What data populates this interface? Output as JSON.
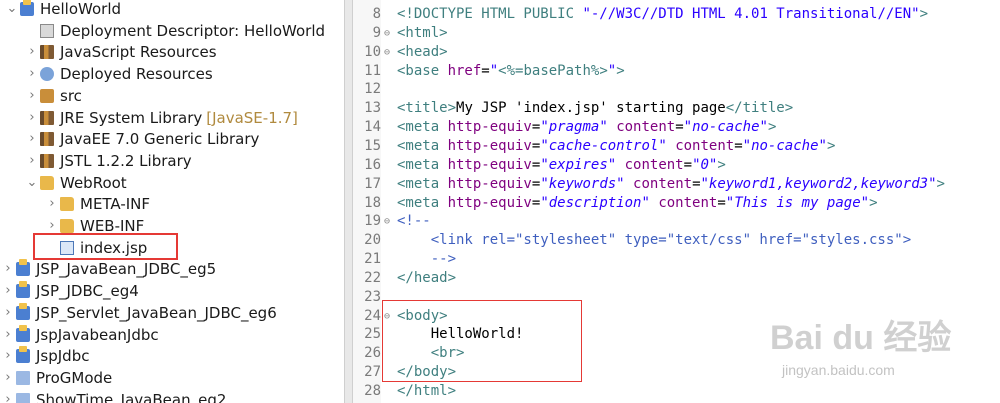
{
  "explorer": {
    "items": [
      {
        "label": "HelloWorld",
        "decoration": "",
        "icon": "project-icon",
        "expanded": true
      },
      {
        "label": "Deployment Descriptor: HelloWorld",
        "decoration": "",
        "icon": "descriptor-icon"
      },
      {
        "label": "JavaScript Resources",
        "decoration": "",
        "icon": "library-icon"
      },
      {
        "label": "Deployed Resources",
        "decoration": "",
        "icon": "deployed-icon"
      },
      {
        "label": "src",
        "decoration": "",
        "icon": "src-icon"
      },
      {
        "label": "JRE System Library",
        "decoration": "[JavaSE-1.7]",
        "icon": "library-icon"
      },
      {
        "label": "JavaEE 7.0 Generic Library",
        "decoration": "",
        "icon": "library-icon"
      },
      {
        "label": "JSTL 1.2.2 Library",
        "decoration": "",
        "icon": "library-icon"
      },
      {
        "label": "WebRoot",
        "decoration": "",
        "icon": "folder-icon",
        "expanded": true
      },
      {
        "label": "META-INF",
        "decoration": "",
        "icon": "folder-icon"
      },
      {
        "label": "WEB-INF",
        "decoration": "",
        "icon": "folder-icon"
      },
      {
        "label": "index.jsp",
        "decoration": "",
        "icon": "jsp-file-icon",
        "highlighted": true
      },
      {
        "label": "JSP_JavaBean_JDBC_eg5",
        "decoration": "",
        "icon": "project-icon"
      },
      {
        "label": "JSP_JDBC_eg4",
        "decoration": "",
        "icon": "project-icon"
      },
      {
        "label": "JSP_Servlet_JavaBean_JDBC_eg6",
        "decoration": "",
        "icon": "project-icon"
      },
      {
        "label": "JspJavabeanJdbc",
        "decoration": "",
        "icon": "project-icon"
      },
      {
        "label": "JspJdbc",
        "decoration": "",
        "icon": "project-icon"
      },
      {
        "label": "ProGMode",
        "decoration": "",
        "icon": "folder-project-icon"
      },
      {
        "label": "ShowTime_JavaBean_eg2",
        "decoration": "",
        "icon": "folder-project-icon"
      }
    ]
  },
  "editor": {
    "lines": [
      {
        "n": "8",
        "fold": "",
        "parts": [
          [
            "t-dt",
            "<!DOCTYPE HTML PUBLIC "
          ],
          [
            "t-str",
            "\"-//W3C//DTD HTML 4.01 Transitional//EN\""
          ],
          [
            "t-dt",
            ">"
          ]
        ]
      },
      {
        "n": "9",
        "fold": "⊖",
        "parts": [
          [
            "t-tag",
            "<html>"
          ]
        ]
      },
      {
        "n": "10",
        "fold": "⊖",
        "parts": [
          [
            "t-tag",
            "<head>"
          ]
        ]
      },
      {
        "n": "11",
        "fold": "",
        "parts": [
          [
            "t-tag",
            "<base "
          ],
          [
            "t-attr",
            "href"
          ],
          [
            "t-text",
            "="
          ],
          [
            "t-str",
            "\""
          ],
          [
            "t-tag",
            "<%=basePath%>"
          ],
          [
            "t-str",
            "\""
          ],
          [
            "t-tag",
            ">"
          ]
        ]
      },
      {
        "n": "12",
        "fold": "",
        "parts": []
      },
      {
        "n": "13",
        "fold": "",
        "parts": [
          [
            "t-tag",
            "<title>"
          ],
          [
            "t-text",
            "My JSP 'index.jsp' starting page"
          ],
          [
            "t-tag",
            "</title>"
          ]
        ]
      },
      {
        "n": "14",
        "fold": "",
        "parts": [
          [
            "t-tag",
            "<meta "
          ],
          [
            "t-attr",
            "http-equiv"
          ],
          [
            "t-text",
            "="
          ],
          [
            "t-str t-it",
            "\"pragma\""
          ],
          [
            "t-text",
            " "
          ],
          [
            "t-attr",
            "content"
          ],
          [
            "t-text",
            "="
          ],
          [
            "t-str t-it",
            "\"no-cache\""
          ],
          [
            "t-tag",
            ">"
          ]
        ]
      },
      {
        "n": "15",
        "fold": "",
        "parts": [
          [
            "t-tag",
            "<meta "
          ],
          [
            "t-attr",
            "http-equiv"
          ],
          [
            "t-text",
            "="
          ],
          [
            "t-str t-it",
            "\"cache-control\""
          ],
          [
            "t-text",
            " "
          ],
          [
            "t-attr",
            "content"
          ],
          [
            "t-text",
            "="
          ],
          [
            "t-str t-it",
            "\"no-cache\""
          ],
          [
            "t-tag",
            ">"
          ]
        ]
      },
      {
        "n": "16",
        "fold": "",
        "parts": [
          [
            "t-tag",
            "<meta "
          ],
          [
            "t-attr",
            "http-equiv"
          ],
          [
            "t-text",
            "="
          ],
          [
            "t-str t-it",
            "\"expires\""
          ],
          [
            "t-text",
            " "
          ],
          [
            "t-attr",
            "content"
          ],
          [
            "t-text",
            "="
          ],
          [
            "t-str t-it",
            "\"0\""
          ],
          [
            "t-tag",
            ">"
          ]
        ]
      },
      {
        "n": "17",
        "fold": "",
        "parts": [
          [
            "t-tag",
            "<meta "
          ],
          [
            "t-attr",
            "http-equiv"
          ],
          [
            "t-text",
            "="
          ],
          [
            "t-str t-it",
            "\"keywords\""
          ],
          [
            "t-text",
            " "
          ],
          [
            "t-attr",
            "content"
          ],
          [
            "t-text",
            "="
          ],
          [
            "t-str t-it",
            "\"keyword1,keyword2,keyword3\""
          ],
          [
            "t-tag",
            ">"
          ]
        ]
      },
      {
        "n": "18",
        "fold": "",
        "parts": [
          [
            "t-tag",
            "<meta "
          ],
          [
            "t-attr",
            "http-equiv"
          ],
          [
            "t-text",
            "="
          ],
          [
            "t-str t-it",
            "\"description\""
          ],
          [
            "t-text",
            " "
          ],
          [
            "t-attr",
            "content"
          ],
          [
            "t-text",
            "="
          ],
          [
            "t-str t-it",
            "\"This is my page\""
          ],
          [
            "t-tag",
            ">"
          ]
        ]
      },
      {
        "n": "19",
        "fold": "⊖",
        "parts": [
          [
            "t-comment",
            "<!--"
          ]
        ]
      },
      {
        "n": "20",
        "fold": "",
        "parts": [
          [
            "t-comment",
            "    <link rel=\"stylesheet\" type=\"text/css\" href=\"styles.css\">"
          ]
        ]
      },
      {
        "n": "21",
        "fold": "",
        "parts": [
          [
            "t-comment",
            "    -->"
          ]
        ]
      },
      {
        "n": "22",
        "fold": "",
        "parts": [
          [
            "t-tag",
            "</head>"
          ]
        ]
      },
      {
        "n": "23",
        "fold": "",
        "parts": []
      },
      {
        "n": "24",
        "fold": "⊖",
        "parts": [
          [
            "t-tag",
            "<body>"
          ]
        ]
      },
      {
        "n": "25",
        "fold": "",
        "parts": [
          [
            "t-text",
            "    HelloWorld!"
          ]
        ]
      },
      {
        "n": "26",
        "fold": "",
        "parts": [
          [
            "t-tag",
            "    <br>"
          ]
        ]
      },
      {
        "n": "27",
        "fold": "",
        "parts": [
          [
            "t-tag",
            "</body>"
          ]
        ]
      },
      {
        "n": "28",
        "fold": "",
        "parts": [
          [
            "t-tag",
            "</html>"
          ]
        ]
      }
    ]
  },
  "watermark": {
    "text": "Bai du 经验",
    "url": "jingyan.baidu.com"
  }
}
